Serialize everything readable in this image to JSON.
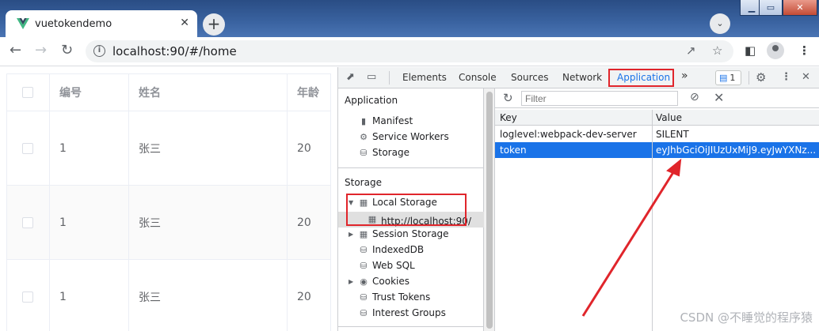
{
  "browser": {
    "tab_title": "vuetokendemo",
    "tab_close": "✕",
    "new_tab": "+",
    "url": "localhost:90/#/home"
  },
  "window_controls": {
    "minimize": "▁",
    "maximize": "▭",
    "close": "✕"
  },
  "table": {
    "headers": [
      "编号",
      "姓名",
      "年龄"
    ],
    "rows": [
      {
        "id": "1",
        "name": "张三",
        "age": "20"
      },
      {
        "id": "1",
        "name": "张三",
        "age": "20"
      },
      {
        "id": "1",
        "name": "张三",
        "age": "20"
      }
    ]
  },
  "devtools": {
    "tabs": [
      "Elements",
      "Console",
      "Sources",
      "Network",
      "Application"
    ],
    "active_tab": "Application",
    "more_tabs": "»",
    "issues_count": "1",
    "sidebar": {
      "application_section": "Application",
      "application_items": [
        "Manifest",
        "Service Workers",
        "Storage"
      ],
      "storage_section": "Storage",
      "local_storage": "Local Storage",
      "local_storage_origin": "http://localhost:90/",
      "storage_items": [
        "Session Storage",
        "IndexedDB",
        "Web SQL",
        "Cookies",
        "Trust Tokens",
        "Interest Groups"
      ]
    },
    "filter_placeholder": "Filter",
    "columns": {
      "key": "Key",
      "value": "Value"
    },
    "entries": [
      {
        "key": "loglevel:webpack-dev-server",
        "value": "SILENT"
      },
      {
        "key": "token",
        "value": "eyJhbGciOiJIUzUxMiJ9.eyJwYXNz..."
      }
    ]
  },
  "watermark": "CSDN @不睡觉的程序猿",
  "colors": {
    "annotation": "#e0252b",
    "selection": "#1a73e8",
    "vue_green": "#41b883"
  }
}
